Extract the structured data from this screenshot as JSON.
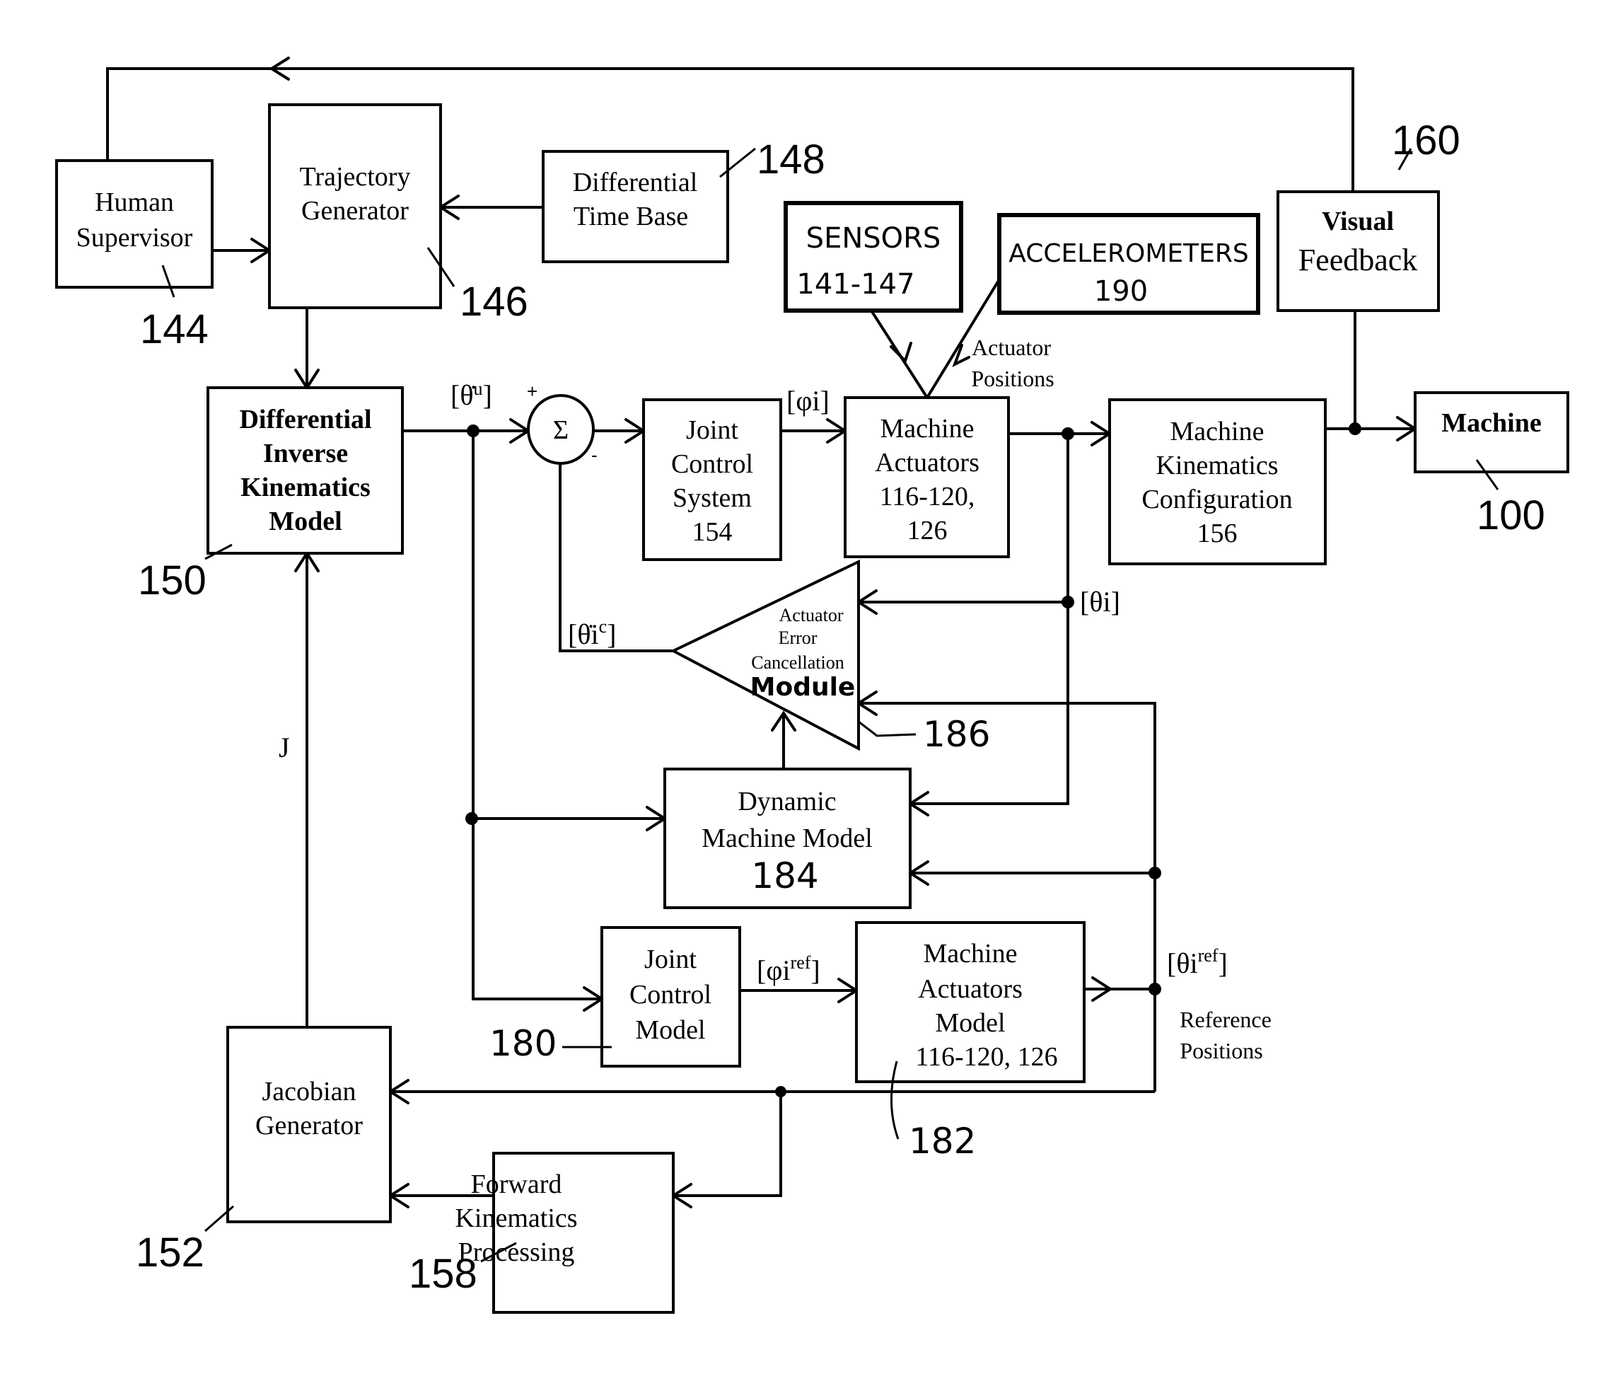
{
  "blocks": {
    "human_supervisor": {
      "lines": [
        "Human",
        "Supervisor"
      ],
      "ref": "144"
    },
    "trajectory_generator": {
      "lines": [
        "Trajectory",
        "Generator"
      ],
      "ref": "146"
    },
    "differential_time_base": {
      "lines": [
        "Differential",
        "Time Base"
      ],
      "ref": "148"
    },
    "sensors": {
      "lines": [
        "SENSORS",
        "141-147"
      ]
    },
    "accelerometers": {
      "lines": [
        "ACCELEROMETERS",
        "190"
      ]
    },
    "visual_feedback": {
      "lines": [
        "Visual",
        "Feedback"
      ],
      "ref": "160"
    },
    "differential_inverse_kinematics": {
      "lines": [
        "Differential",
        "Inverse",
        "Kinematics",
        "Model"
      ],
      "ref": "150"
    },
    "summation": {
      "symbol": "Σ",
      "plus": "+",
      "minus": "-"
    },
    "joint_control_system": {
      "lines": [
        "Joint",
        "Control",
        "System",
        "154"
      ]
    },
    "machine_actuators": {
      "lines": [
        "Machine",
        "Actuators",
        "116-120,",
        "126"
      ]
    },
    "machine_kinematics_configuration": {
      "lines": [
        "Machine",
        "Kinematics",
        "Configuration",
        "156"
      ]
    },
    "machine": {
      "lines": [
        "Machine"
      ],
      "ref": "100"
    },
    "actuator_error_cancellation": {
      "lines": [
        "Actuator",
        "Error",
        "Cancellation",
        "Module"
      ],
      "ref": "186"
    },
    "dynamic_machine_model": {
      "lines": [
        "Dynamic",
        "Machine Model",
        "184"
      ]
    },
    "joint_control_model": {
      "lines": [
        "Joint",
        "Control",
        "Model"
      ],
      "ref": "180"
    },
    "machine_actuators_model": {
      "lines": [
        "Machine",
        "Actuators",
        "Model",
        "116-120, 126"
      ],
      "ref": "182"
    },
    "jacobian_generator": {
      "lines": [
        "Jacobian",
        "Generator"
      ],
      "ref": "152"
    },
    "forward_kinematics": {
      "lines": [
        "Forward",
        "Kinematics",
        "Processing"
      ],
      "ref": "158"
    }
  },
  "signals": {
    "theta_u": {
      "open": "[",
      "base": "θ̇",
      "sup": "u",
      "close": "]"
    },
    "phi_i": {
      "text": "[φi]"
    },
    "theta_i": {
      "text": "[θi]"
    },
    "theta_i_c": {
      "open": "[",
      "base": "θ̇i",
      "sup": "c",
      "close": "]"
    },
    "phi_i_ref": {
      "open": "[",
      "base": "φi",
      "sup": "ref",
      "close": "]"
    },
    "theta_i_ref": {
      "open": "[",
      "base": "θi",
      "sup": "ref",
      "close": "]"
    },
    "jacobian": "J",
    "actuator_positions": [
      "Actuator",
      "Positions"
    ],
    "reference_positions": [
      "Reference",
      "Positions"
    ]
  }
}
